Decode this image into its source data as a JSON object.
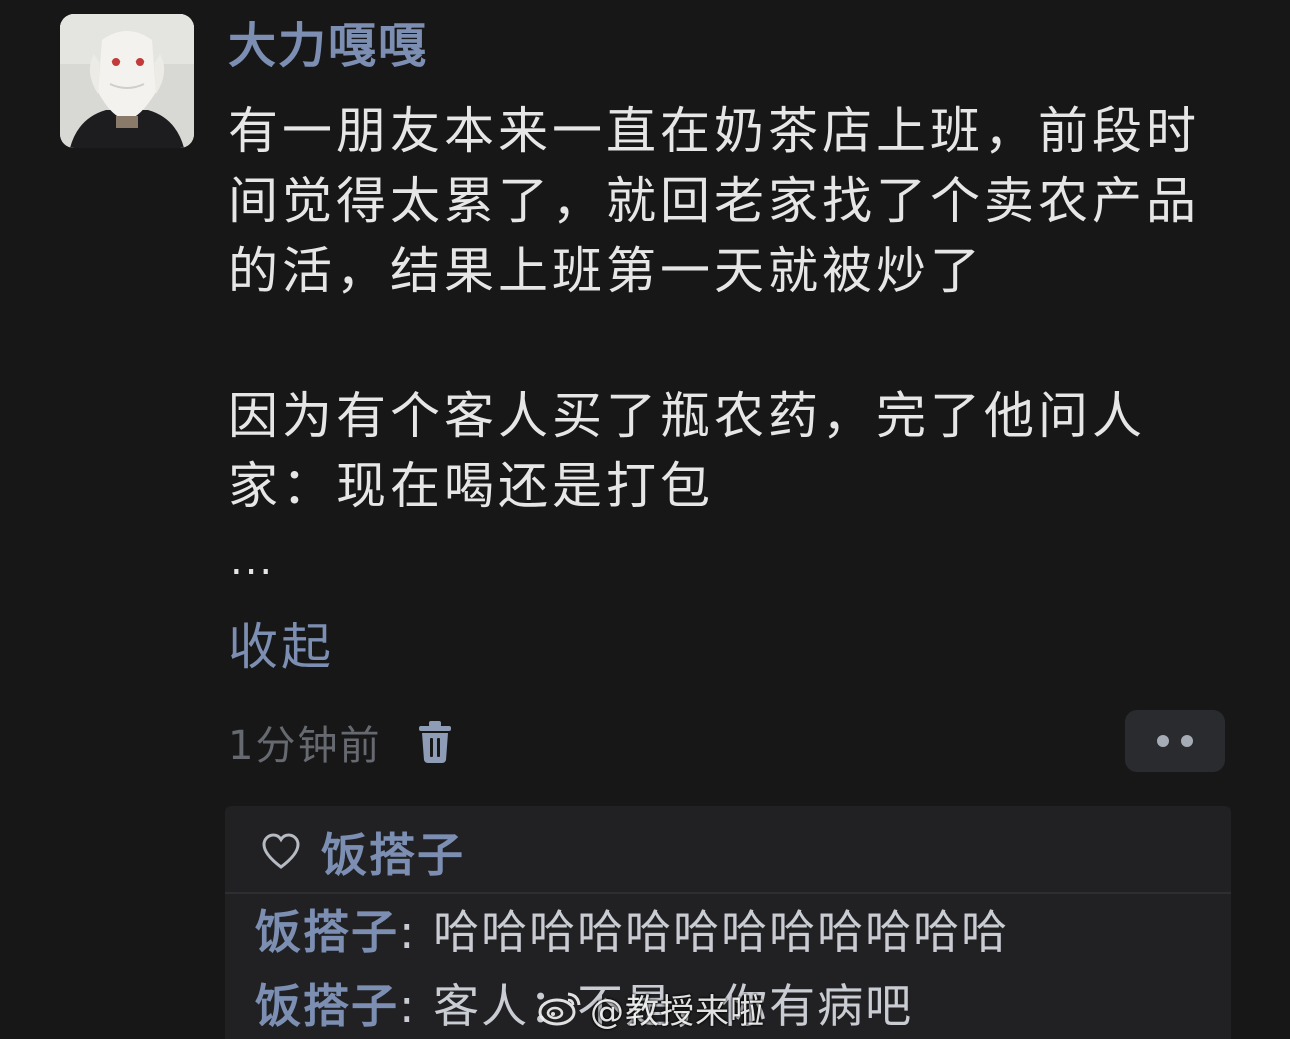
{
  "comment": {
    "author": "大力嘎嘎",
    "lines": [
      "有一朋友本来一直在奶茶店上班，前段时",
      "间觉得太累了，就回老家找了个卖农产品",
      "的活，结果上班第一天就被炒了",
      "因为有个客人买了瓶农药，完了他问人",
      "家：现在喝还是打包"
    ],
    "ellipsis": "...",
    "collapse_label": "收起",
    "timestamp": "1分钟前"
  },
  "icons": {
    "delete": "trash-icon",
    "more": "more-dots-icon",
    "like": "heart-outline-icon",
    "watermark_logo": "weibo-logo-icon"
  },
  "replies": {
    "liked_by": "饭搭子",
    "items": [
      {
        "author": "饭搭子",
        "separator": ":",
        "text": "哈哈哈哈哈哈哈哈哈哈哈哈"
      },
      {
        "author": "饭搭子",
        "separator": ":",
        "text": "客人：不是，你有病吧"
      }
    ]
  },
  "watermark": {
    "text": "@教授来啦"
  },
  "colors": {
    "background": "#171718",
    "accent_link": "#7c8fb3",
    "body_text": "#e6e6e6",
    "muted_text": "#666a70",
    "panel_bg": "#212123"
  }
}
